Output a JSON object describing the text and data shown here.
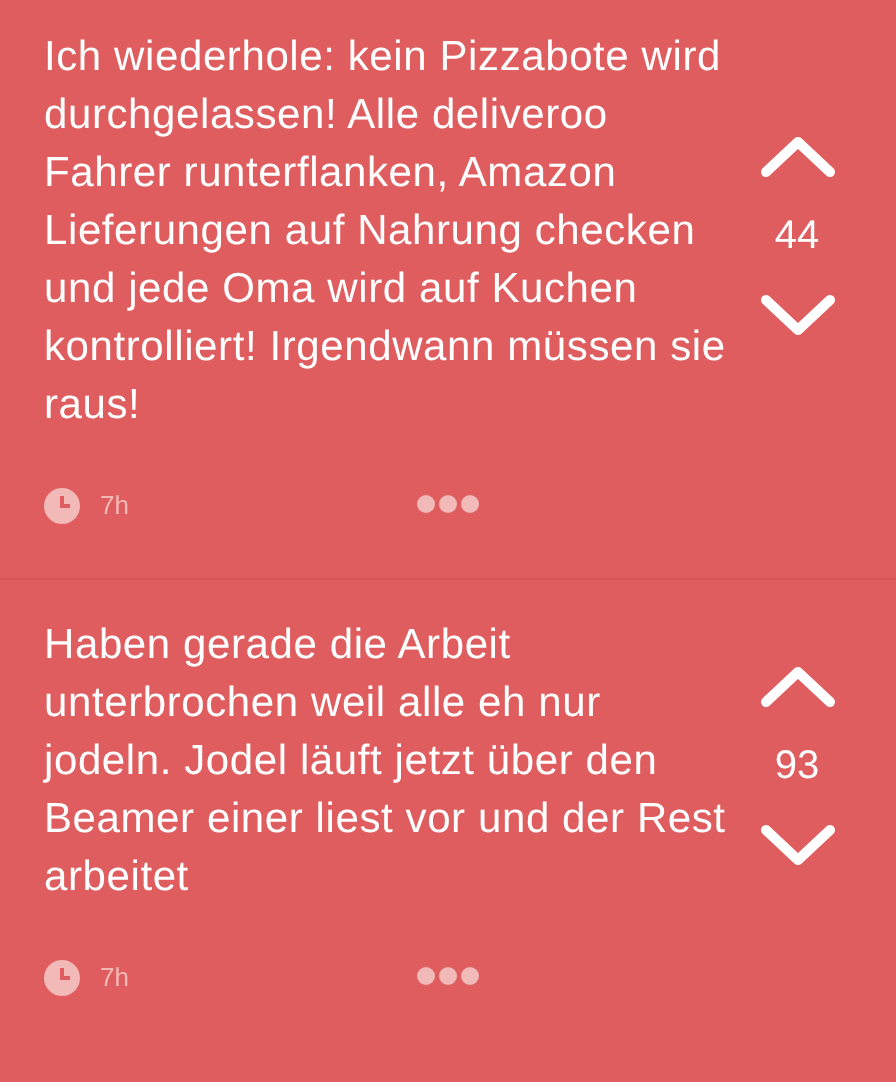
{
  "posts": [
    {
      "text": "Ich wiederhole: kein Pizzabote wird durchgelassen! Alle deliveroo Fahrer runterflanken, Amazon Lieferungen auf Nahrung checken und jede Oma wird auf Kuchen kontrolliert! Irgendwann müssen sie raus!",
      "votes": "44",
      "time": "7h"
    },
    {
      "text": "Haben gerade die Arbeit unterbrochen weil alle eh nur jodeln. Jodel läuft jetzt über den Beamer einer liest vor und der Rest arbeitet",
      "votes": "93",
      "time": "7h"
    }
  ]
}
